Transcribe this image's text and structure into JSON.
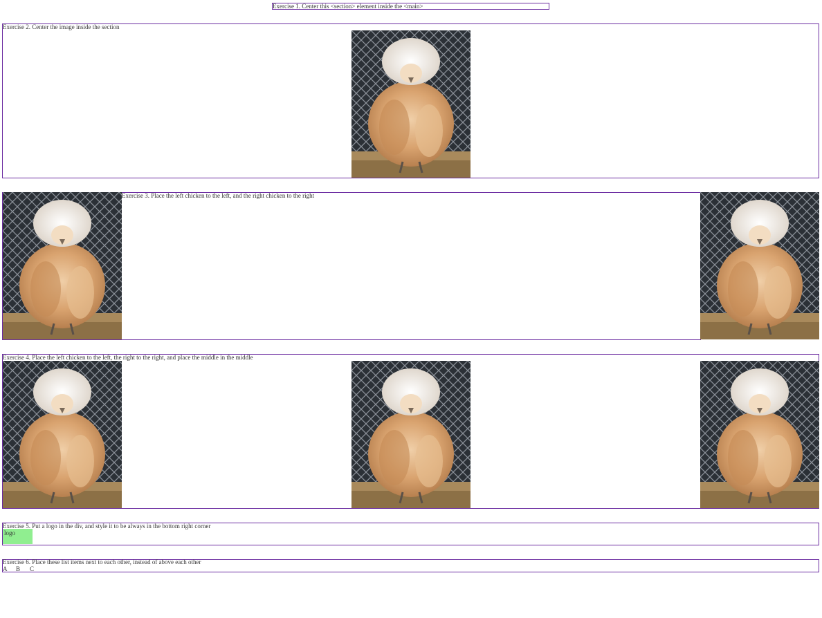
{
  "ex1": {
    "label": "Exercise 1. Center this <section> element inside the <main>"
  },
  "ex2": {
    "label": "Exercise 2. Center the image inside the section"
  },
  "ex3": {
    "label": "Exercise 3. Place the left chicken to the left, and the right chicken to the right"
  },
  "ex4": {
    "label": "Exercise 4. Place the left chicken to the left, the right to the right, and place the middle in the middle"
  },
  "ex5": {
    "label": "Exercise 5. Put a logo in the div, and style it to be always in the bottom right corner",
    "logo_alt": "logo"
  },
  "ex6": {
    "label": "Exercise 6. Place these list items next to each other, instead of above each other",
    "items": [
      "A",
      "B",
      "C"
    ]
  },
  "colors": {
    "border": "#6a2aa0",
    "logo_bg": "#90ee90"
  },
  "images": {
    "chicken_alt": "fluffy chicken photo"
  }
}
